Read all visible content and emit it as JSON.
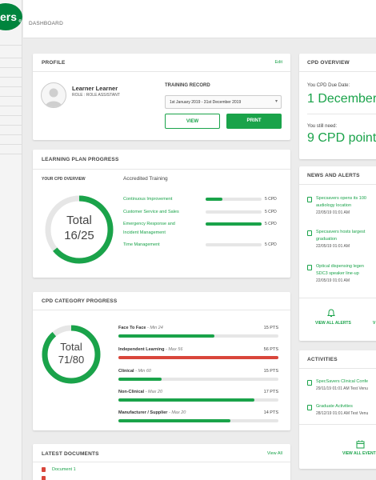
{
  "brand": {
    "logo_text": "ers",
    "reg_mark": "®"
  },
  "breadcrumb": "DASHBOARD",
  "profile": {
    "title": "PROFILE",
    "edit_label": "Edit",
    "name": "Learner Learner",
    "role": "ROLE : ROLE ASSISTANT",
    "training_record_label": "TRAINING RECORD",
    "date_range": "1st January 2019 - 31st December 2019",
    "view_label": "VIEW",
    "print_label": "PRINT"
  },
  "learning_plan": {
    "title": "LEARNING PLAN PROGRESS",
    "overview_label": "YOUR CPD OVERVIEW",
    "accredited_label": "Accredited Training",
    "total_label": "Total",
    "total_value": "16/25",
    "progress_fraction": 0.64,
    "items": [
      {
        "label": "Continuous Improvement",
        "value": "5 CPD",
        "progress": 0.3
      },
      {
        "label": "Customer Service and Sales",
        "value": "5 CPD",
        "progress": 0.0
      },
      {
        "label": "Emergency Response and",
        "label2": "Incident Management",
        "value": "5 CPD",
        "progress": 1.0
      },
      {
        "label": "Time Management",
        "value": "5 CPD",
        "progress": 0.0
      }
    ]
  },
  "cpd_category": {
    "title": "CPD CATEGORY PROGRESS",
    "total_label": "Total",
    "total_value": "71/80",
    "progress_fraction": 0.8875,
    "items": [
      {
        "name": "Face To Face",
        "limit": "Min 24",
        "pts": "15 PTS",
        "progress": 0.6,
        "color": "#1aa34a"
      },
      {
        "name": "Independent Learning",
        "limit": "Max 56",
        "pts": "56 PTS",
        "progress": 1.0,
        "color": "#d9463b"
      },
      {
        "name": "Clinical",
        "limit": "Min 60",
        "pts": "15 PTS",
        "progress": 0.27,
        "color": "#1aa34a"
      },
      {
        "name": "Non-Clinical",
        "limit": "Max 20",
        "pts": "17 PTS",
        "progress": 0.85,
        "color": "#1aa34a"
      },
      {
        "name": "Manufacturer / Supplier",
        "limit": "Max 20",
        "pts": "14 PTS",
        "progress": 0.7,
        "color": "#1aa34a"
      }
    ]
  },
  "documents": {
    "title": "LATEST DOCUMENTS",
    "view_all": "View All",
    "items": [
      {
        "name": "Document 1"
      }
    ]
  },
  "cpd_overview": {
    "title": "CPD OVERVIEW",
    "due_label": "You CPD Due Date:",
    "due_value": "1 December",
    "need_label": "You still need:",
    "need_value": "9 CPD point"
  },
  "news": {
    "title": "NEWS AND ALERTS",
    "items": [
      {
        "line1": "Specsavers opens its 100",
        "line2": "audiology location",
        "date": "22/05/19 01:01 AM"
      },
      {
        "line1": "Specsavers hosts largest",
        "line2": "graduation",
        "date": "22/05/19 01:01 AM"
      },
      {
        "line1": "Optical dispensing legen",
        "line2": "SDC3 speaker line-up",
        "date": "22/05/19 01:01 AM"
      }
    ],
    "view_all_alerts": "VIEW ALL ALERTS",
    "view_all_partial": "V"
  },
  "activities": {
    "title": "ACTIVITIES",
    "items": [
      {
        "line1": "SpecSavers Clinical Confe",
        "line2": "29/11/19 01:01 AM Test Venu"
      },
      {
        "line1": "Graduate Activities",
        "line2": "28/12/19 01:01 AM Test Venu"
      }
    ],
    "view_all_events": "VIEW ALL EVENT"
  },
  "colors": {
    "accent": "#1aa34a",
    "alert": "#d9463b",
    "track": "#e6e6e6"
  }
}
